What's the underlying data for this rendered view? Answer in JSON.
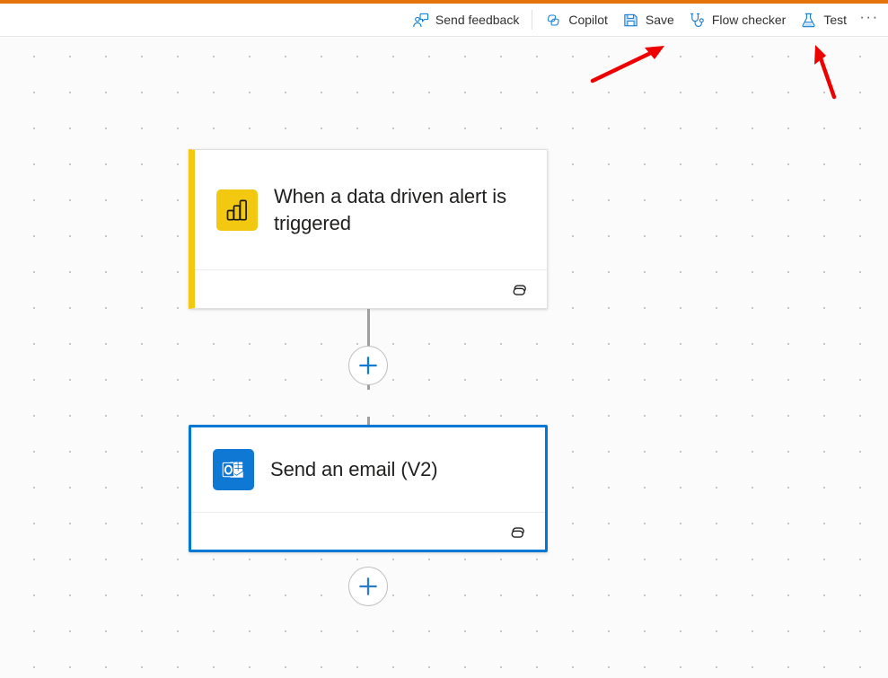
{
  "theme": {
    "accent_bar_color": "#e4730b",
    "brand_blue": "#0078d4",
    "powerbi_yellow": "#f2c811",
    "outlook_blue": "#0f78d4",
    "annotation_red": "#ee0000",
    "canvas_background": "#fbfbfb"
  },
  "command_bar": {
    "items": [
      {
        "id": "send-feedback",
        "label": "Send feedback",
        "icon": "feedback-person-icon"
      },
      {
        "id": "copilot",
        "label": "Copilot",
        "icon": "copilot-icon"
      },
      {
        "id": "save",
        "label": "Save",
        "icon": "save-floppy-icon"
      },
      {
        "id": "flow-checker",
        "label": "Flow checker",
        "icon": "stethoscope-icon"
      },
      {
        "id": "test",
        "label": "Test",
        "icon": "beaker-flask-icon"
      }
    ],
    "overflow_label": "···"
  },
  "canvas": {
    "nodes": [
      {
        "id": "trigger",
        "title": "When a data driven alert is triggered",
        "app_icon": "powerbi-icon",
        "accent_color": "#f2c811",
        "selected": false,
        "footer_icon": "link-chain-icon"
      },
      {
        "id": "action-send-email",
        "title": "Send an email (V2)",
        "app_icon": "outlook-icon",
        "accent_color": "#0078d4",
        "selected": true,
        "footer_icon": "link-chain-icon"
      }
    ],
    "insert_buttons": [
      {
        "id": "insert-between",
        "icon": "plus-icon"
      },
      {
        "id": "insert-end",
        "icon": "plus-icon"
      }
    ]
  },
  "annotations": [
    {
      "id": "arrow-to-save",
      "icon": "red-arrow-up-right"
    },
    {
      "id": "arrow-to-test",
      "icon": "red-arrow-up-left"
    }
  ]
}
